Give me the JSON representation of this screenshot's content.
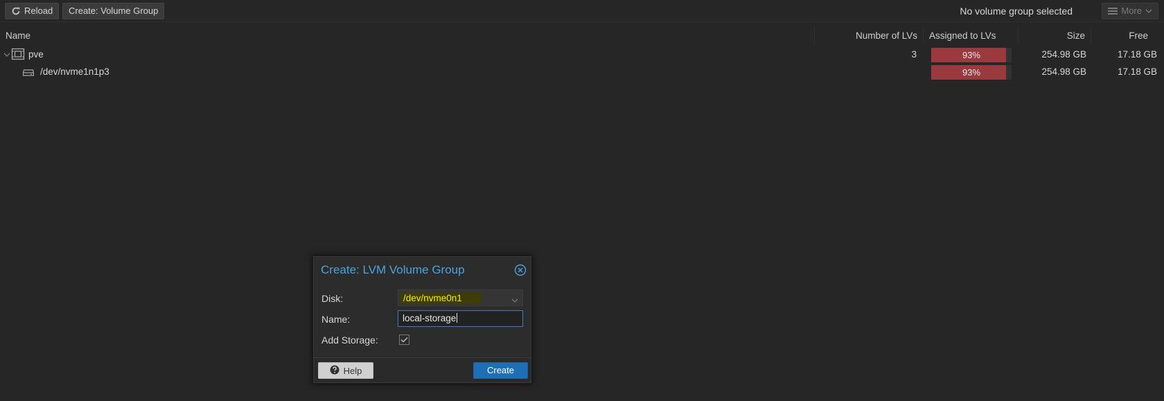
{
  "toolbar": {
    "reload_label": "Reload",
    "create_vg_label": "Create: Volume Group",
    "status_text": "No volume group selected",
    "more_label": "More"
  },
  "grid": {
    "columns": {
      "name": "Name",
      "num_lvs": "Number of LVs",
      "assigned": "Assigned to LVs",
      "size": "Size",
      "free": "Free"
    },
    "rows": [
      {
        "name": "pve",
        "num_lvs": "3",
        "assigned_pct": 93,
        "assigned_text": "93%",
        "size": "254.98 GB",
        "free": "17.18 GB",
        "icon": "volume-group-icon"
      },
      {
        "name": "/dev/nvme1n1p3",
        "num_lvs": "",
        "assigned_pct": 93,
        "assigned_text": "93%",
        "size": "254.98 GB",
        "free": "17.18 GB",
        "icon": "hard-disk-icon"
      }
    ]
  },
  "dialog": {
    "title": "Create: LVM Volume Group",
    "disk_label": "Disk:",
    "disk_value": "/dev/nvme0n1",
    "name_label": "Name:",
    "name_value": "local-storage",
    "add_storage_label": "Add Storage:",
    "add_storage_checked": true,
    "help_label": "Help",
    "create_label": "Create"
  },
  "colors": {
    "accent": "#4aa3df",
    "usage_bar": "#9a3a3f",
    "primary_button": "#1f6fb4",
    "highlight": "#f2f200"
  }
}
